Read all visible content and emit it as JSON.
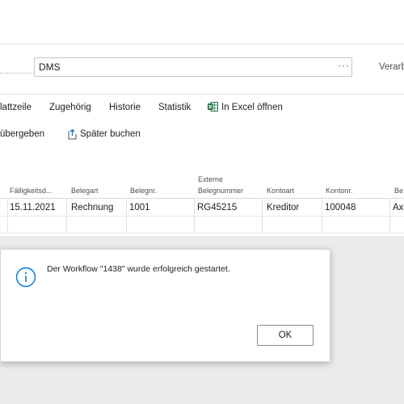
{
  "field": {
    "value": "DMS",
    "more": "···"
  },
  "header_action": "Verarb",
  "menu": [
    "lattzeile",
    "Zugehörig",
    "Historie",
    "Statistik",
    "In Excel öffnen"
  ],
  "actions": [
    "übergeben",
    "Später buchen"
  ],
  "table": {
    "columns": [
      "Fälligkeitsd...",
      "Belegart",
      "Belegnr.",
      "Externe",
      "Belegnummer",
      "Kontoart",
      "Kontonr.",
      "Be"
    ],
    "row": [
      "15.11.2021",
      "Rechnung",
      "1001",
      "RG45215",
      "Kreditor",
      "100048",
      "Axi"
    ]
  },
  "dialog": {
    "message": "Der Workflow \"1438\" wurde erfolgreich gestartet.",
    "ok_label": "OK"
  },
  "colors": {
    "accent": "#0078d4",
    "excel": "#217346",
    "overlay": "#ebebeb"
  }
}
